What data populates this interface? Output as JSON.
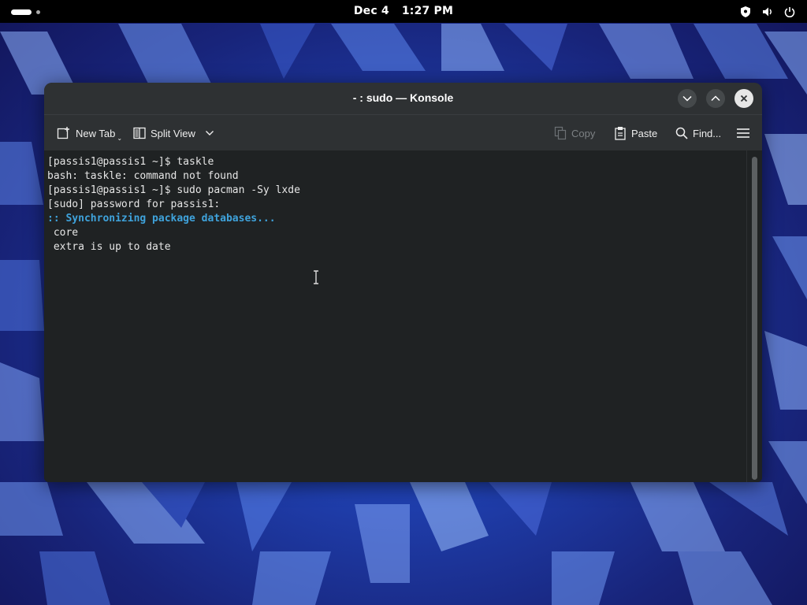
{
  "topbar": {
    "date": "Dec 4",
    "time": "1:27 PM",
    "icons": [
      "shield-icon",
      "volume-icon",
      "power-icon"
    ]
  },
  "window": {
    "title": "- : sudo — Konsole",
    "controls": [
      "minimize",
      "maximize",
      "close"
    ]
  },
  "toolbar": {
    "new_tab": "New Tab",
    "split_view": "Split View",
    "copy": "Copy",
    "paste": "Paste",
    "find": "Find..."
  },
  "terminal": {
    "lines": [
      "[passis1@passis1 ~]$ taskle",
      "bash: taskle: command not found",
      "[passis1@passis1 ~]$ sudo pacman -Sy lxde",
      "[sudo] password for passis1:",
      ":: Synchronizing package databases...",
      " core",
      " extra is up to date"
    ],
    "highlight_line_index": 4
  },
  "colors": {
    "accent_text": "#3fa3dc",
    "terminal_bg": "#1f2223",
    "titlebar_bg": "#2e3133"
  }
}
